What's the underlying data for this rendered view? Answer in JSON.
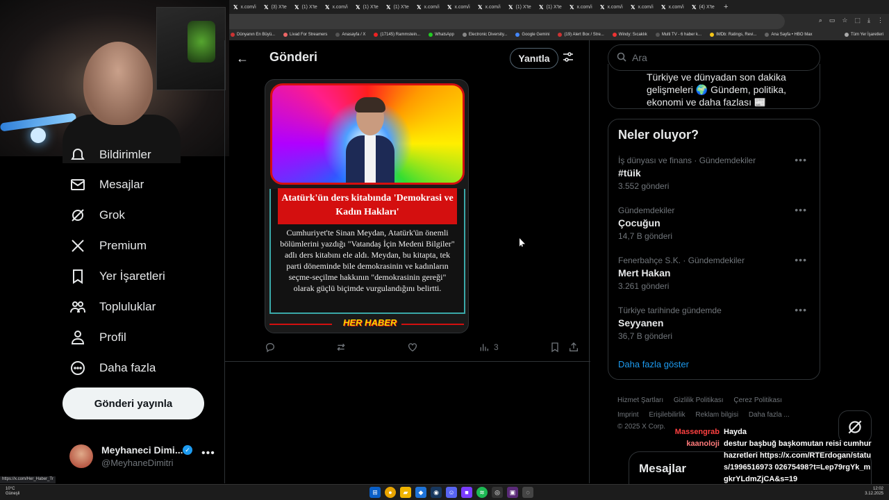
{
  "browser": {
    "tabs": [
      "x.com/i",
      "(3) X'te",
      "(1) X'te",
      "x.com/i",
      "(1) X'te",
      "(1) X'te",
      "x.com/i",
      "x.com/i",
      "x.com/i",
      "(1) X'te",
      "(1) X'te",
      "x.com/i",
      "x.com/i",
      "x.com/i",
      "x.com/i",
      "(4) X'te"
    ],
    "bookmarks": [
      "Dünyanın En Büyü...",
      "Livad For Streamers",
      "Anasayfa / X",
      "(17145) Rammstein...",
      "WhatsApp",
      "Electronic Diversity...",
      "Google Gemini",
      "(19) Alert Box / Stre...",
      "Windy: Sıcaklık",
      "Multi TV - 6 haber k...",
      "IMDb: Ratings, Revi...",
      "Ana Sayfa • HBO Max",
      "Tüm Yer İşaretleri"
    ],
    "status_url": "https://x.com/Her_Haber_Tr"
  },
  "sidebar": {
    "partial_label": "Bildirimler",
    "items": [
      {
        "label": "Mesajlar",
        "icon": "mail-icon"
      },
      {
        "label": "Grok",
        "icon": "grok-icon"
      },
      {
        "label": "Premium",
        "icon": "x-logo-icon"
      },
      {
        "label": "Yer İşaretleri",
        "icon": "bookmark-icon"
      },
      {
        "label": "Topluluklar",
        "icon": "communities-icon"
      },
      {
        "label": "Profil",
        "icon": "person-icon"
      },
      {
        "label": "Daha fazla",
        "icon": "more-circle-icon"
      }
    ],
    "post_button": "Gönderi yayınla",
    "account": {
      "name": "Meyhaneci Dimi...",
      "handle": "@MeyhaneDimitri",
      "verified": true
    }
  },
  "main": {
    "back_label": "←",
    "title": "Gönderi",
    "reply_button": "Yanıtla",
    "card": {
      "headline": "Atatürk'ün ders kitabında 'Demokrasi ve Kadın Hakları'",
      "body": "Cumhuriyet'te Sinan Meydan, Atatürk'ün önemli bölümlerini yazdığı \"Vatandaş İçin Medeni Bilgiler\" adlı ders kitabını ele aldı. Meydan, bu kitapta, tek parti döneminde bile demokrasinin ve kadınların seçme-seçilme hakkının \"demokrasinin gereği\" olarak güçlü biçimde vurgulandığını belirtti.",
      "brand": "HER HABER"
    },
    "actions": {
      "views": "3"
    }
  },
  "right": {
    "search_placeholder": "Ara",
    "promo_text": "Türkiye ve dünyadan son dakika gelişmeleri 🌍 Gündem, politika, ekonomi ve daha fazlası 📰",
    "trends_title": "Neler oluyor?",
    "trends": [
      {
        "context": "İş dünyası ve finans · Gündemdekiler",
        "name": "#tüik",
        "posts": "3.552 gönderi"
      },
      {
        "context": "Gündemdekiler",
        "name": "Çocuğun",
        "posts": "14,7 B gönderi"
      },
      {
        "context": "Fenerbahçe S.K. · Gündemdekiler",
        "name": "Mert Hakan",
        "posts": "3.261 gönderi"
      },
      {
        "context": "Türkiye tarihinde gündemde",
        "name": "Seyyanen",
        "posts": "36,7 B gönderi"
      }
    ],
    "show_more": "Daha fazla göster",
    "footer": [
      "Hizmet Şartları",
      "Gizlilik Politikası",
      "Çerez Politikası",
      "Imprint",
      "Erişilebilirlik",
      "Reklam bilgisi",
      "Daha fazla ...",
      "© 2025 X Corp."
    ],
    "messages_dock": "Mesajlar"
  },
  "chat_overlay": [
    {
      "user": "Massengrab",
      "message": "Hayda"
    },
    {
      "user": "kaanoloji",
      "message": "destur başbuğ başkomutan reisi cumhur hazretleri https://x.com/RTErdogan/status/1996516973 02675498?t=Lep79rgYk_mgkrYLdmZjCA&s=19"
    }
  ],
  "taskbar": {
    "weather_temp": "10°C",
    "weather_desc": "Güneşli",
    "time": "12:02",
    "date": "3.12.2025"
  },
  "colors": {
    "accent": "#1d9bf0",
    "background": "#000000",
    "border": "#2f3336",
    "muted": "#71767b",
    "card_red": "#d40f0f"
  }
}
